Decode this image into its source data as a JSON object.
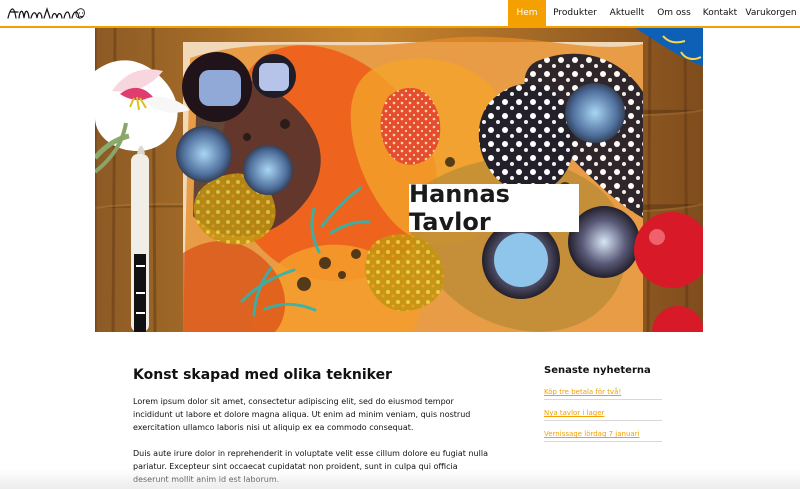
{
  "site": {
    "logo_text": "Hanna",
    "hero_title": "Hannas Tavlor"
  },
  "nav": {
    "items": [
      {
        "label": "Hem",
        "active": true
      },
      {
        "label": "Produkter",
        "active": false
      },
      {
        "label": "Aktuellt",
        "active": false
      },
      {
        "label": "Om oss",
        "active": false
      },
      {
        "label": "Kontakt",
        "active": false
      },
      {
        "label": "Varukorgen",
        "active": false
      }
    ]
  },
  "main": {
    "heading": "Konst skapad med olika tekniker",
    "paragraphs": [
      "Lorem ipsum dolor sit amet, consectetur adipiscing elit, sed do eiusmod tempor incididunt ut labore et dolore magna aliqua. Ut enim ad minim veniam, quis nostrud exercitation ullamco laboris nisi ut aliquip ex ea commodo consequat.",
      "Duis aute irure dolor in reprehenderit in voluptate velit esse cillum dolore eu fugiat nulla pariatur. Excepteur sint occaecat cupidatat non proident, sunt in culpa qui officia deserunt mollit anim id est laborum."
    ]
  },
  "sidebar": {
    "title": "Senaste nyheterna",
    "links": [
      "Köp tre betala för två!",
      "Nya tavlor i lager",
      "Vernissage lördag 7 januari"
    ]
  },
  "theme": {
    "accent": "#f3a000"
  }
}
